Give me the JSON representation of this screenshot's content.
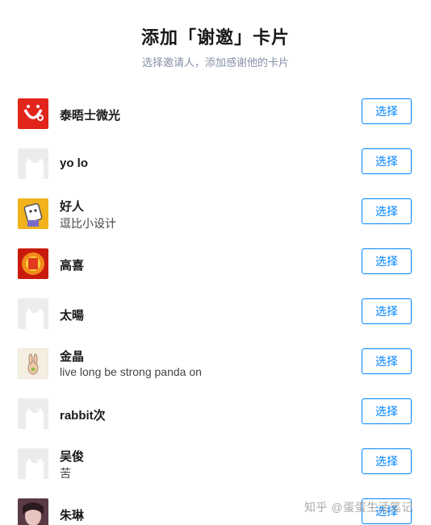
{
  "dialog": {
    "title": "添加「谢邀」卡片",
    "subtitle": "选择邀请人，添加感谢他的卡片"
  },
  "users": [
    {
      "name": "泰晤士微光",
      "bio": "",
      "avatar": "red-smiley-avatar",
      "button": "选择"
    },
    {
      "name": "yo lo",
      "bio": "",
      "avatar": "default-avatar",
      "button": "选择"
    },
    {
      "name": "好人",
      "bio": "逗比小设计",
      "avatar": "cartoon-character-avatar",
      "button": "选择"
    },
    {
      "name": "高喜",
      "bio": "",
      "avatar": "fire-avatar",
      "button": "选择"
    },
    {
      "name": "太暘",
      "bio": "",
      "avatar": "default-avatar",
      "button": "选择"
    },
    {
      "name": "金晶",
      "bio": "live long be strong panda on",
      "avatar": "rabbit-sketch-avatar",
      "button": "选择"
    },
    {
      "name": "rabbit次",
      "bio": "",
      "avatar": "default-avatar",
      "button": "选择"
    },
    {
      "name": "吴俊",
      "bio": "苦",
      "avatar": "default-avatar",
      "button": "选择"
    },
    {
      "name": "朱琳",
      "bio": "",
      "avatar": "photo-avatar",
      "button": "选择"
    }
  ],
  "watermark": "知乎 @蛋蛋生活笔记",
  "colors": {
    "accent": "#0084ff",
    "subtitle": "#8590a6",
    "default_avatar_bg": "#ececec"
  }
}
